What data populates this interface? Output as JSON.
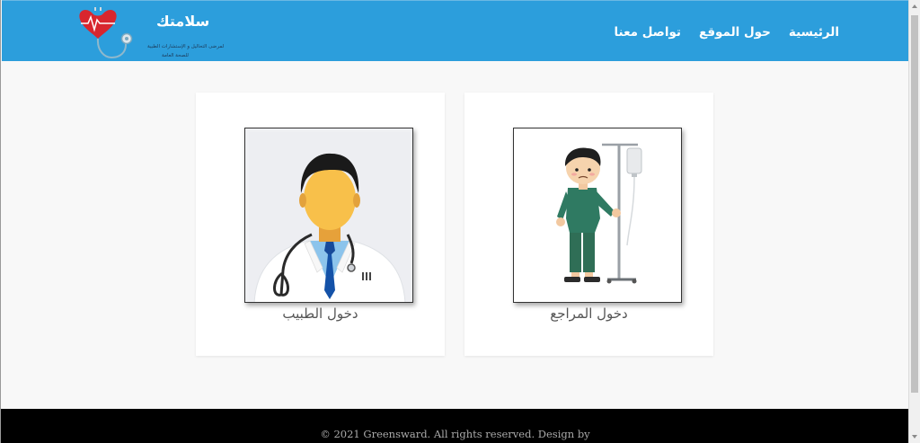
{
  "brand": {
    "title": "سلامتك",
    "subtitle_line1": "لمرضى التحاليل و الإستشارات الطبية",
    "subtitle_line2": "للصحة العامة"
  },
  "nav": {
    "items": [
      {
        "label": "الرئيسية"
      },
      {
        "label": "حول الموقع"
      },
      {
        "label": "تواصل معنا"
      }
    ]
  },
  "cards": {
    "doctor": {
      "label": "دخول الطبيب",
      "icon": "doctor-illustration"
    },
    "patient": {
      "label": "دخول المراجع",
      "icon": "patient-iv-illustration"
    }
  },
  "footer": {
    "text": "© 2021 Greensward. All rights reserved. Design by"
  },
  "colors": {
    "navbar": "#2c9edc",
    "footer": "#000000",
    "background": "#f8f8f8"
  }
}
